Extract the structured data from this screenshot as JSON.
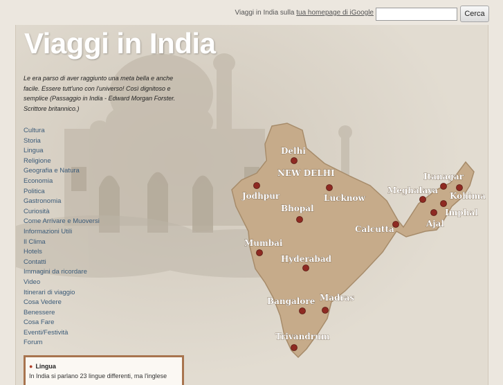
{
  "top_bar": {
    "hint_text": "Viaggi in India sulla ",
    "hint_link": "tua homepage di iGoogle",
    "search_placeholder": "",
    "search_button": "Cerca"
  },
  "site_title": "Viaggi in India",
  "quote": "Le era parso di aver raggiunto una meta bella e anche facile. Essere tutt'uno con l'universo! Così dignitoso e semplice (Passaggio in India - Edward Morgan Forster. Scrittore britannico.)",
  "nav": [
    "Cultura",
    "Storia",
    "Lingua",
    "Religione",
    "Geografia e Natura",
    "Economia",
    "Politica",
    "Gastronomia",
    "Curiosità",
    "Come Arrivare e Muoversi",
    "Informazioni Utili",
    "Il Clima",
    "Hotels",
    "Contatti",
    "Immagini da ricordare",
    "Video",
    "Itinerari di viaggio",
    "Cosa Vedere",
    "Benessere",
    "Cosa Fare",
    "Eventi/Festività",
    "Forum"
  ],
  "map": {
    "cities": {
      "delhi": "Delhi",
      "new_delhi": "NEW DELHI",
      "jodhpur": "Jodhpur",
      "lucknow": "Lucknow",
      "bhopal": "Bhopal",
      "calcutta": "Calcutta",
      "mumbai": "Mumbai",
      "hyderabad": "Hyderabad",
      "bangalore": "Bangalore",
      "madras": "Madras",
      "trivandrum": "Trivandrum",
      "itanagar": "Itanagar",
      "meghalaya": "Meghalaya",
      "kohima": "Kohima",
      "imphal": "Imphal",
      "ajal": "Ajal"
    }
  },
  "info_box": {
    "title": "Lingua",
    "text": "In India si parlano 23 lingue differenti, ma l'inglese"
  },
  "colors": {
    "page_bg": "#ece7df",
    "title": "#ffffff",
    "nav_link": "#3a5a78",
    "map_fill": "#c6ab8a",
    "city_dot": "#8e2a22",
    "box_border": "#a8744e"
  }
}
